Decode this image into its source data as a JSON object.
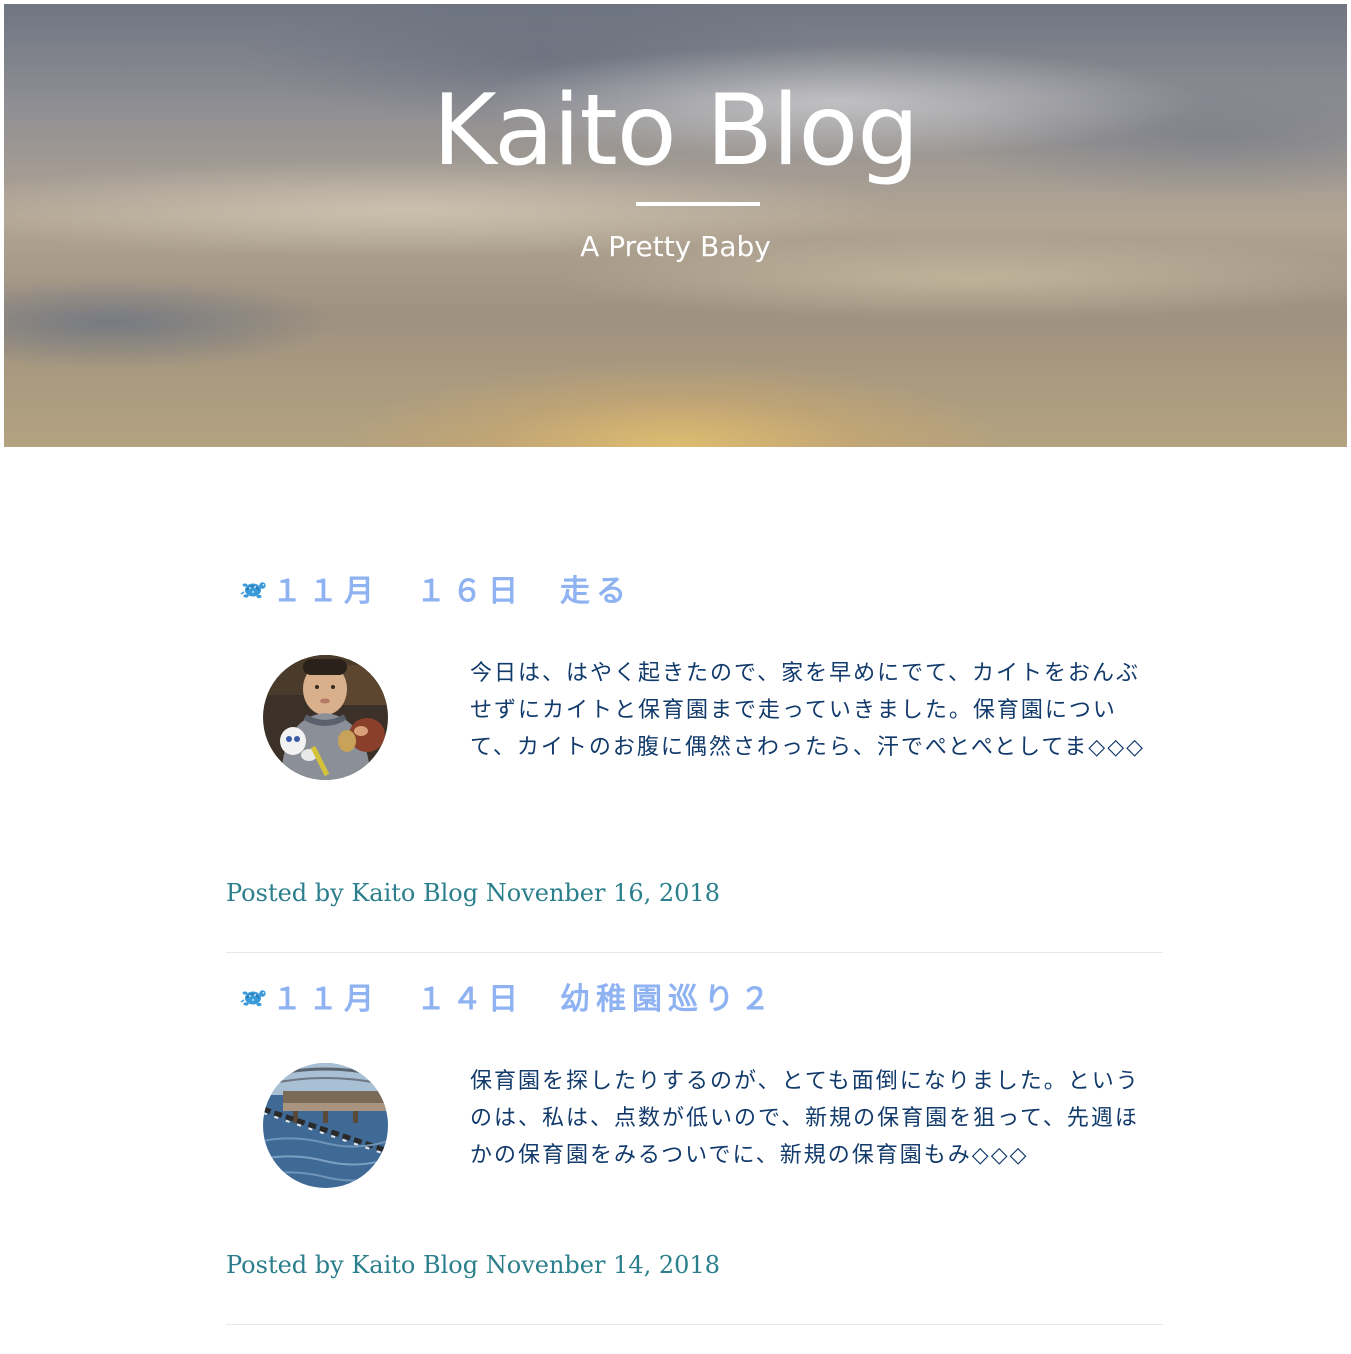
{
  "site": {
    "title": "Kaito Blog",
    "tagline": "A Pretty Baby"
  },
  "posts": [
    {
      "title": "１１月　１６日　走る",
      "title_icon": "turtle-icon",
      "thumbnail": "child-photo",
      "excerpt": "今日は、はやく起きたので、家を早めにでて、カイトをおんぶせずにカイトと保育園まで走っていきました。保育園について、カイトのお腹に偶然さわったら、汗でぺとぺとしてま◇◇◇",
      "meta": {
        "posted_by_label": "Posted by",
        "author": "Kaito Blog",
        "date": "Novenber 16, 2018"
      }
    },
    {
      "title": "１１月　１４日　幼稚園巡り２",
      "title_icon": "turtle-icon",
      "thumbnail": "harbor-photo",
      "excerpt": "保育園を探したりするのが、とても面倒になりました。というのは、私は、点数が低いので、新規の保育園を狙って、先週ほかの保育園をみるついでに、新規の保育園もみ◇◇◇",
      "meta": {
        "posted_by_label": "Posted by",
        "author": "Kaito Blog",
        "date": "Novenber 14, 2018"
      }
    }
  ],
  "colors": {
    "post_title": "#8fb3f2",
    "excerpt_text": "#123a6b",
    "meta_text": "#2b7f8c",
    "separator": "#e8e8e8"
  }
}
